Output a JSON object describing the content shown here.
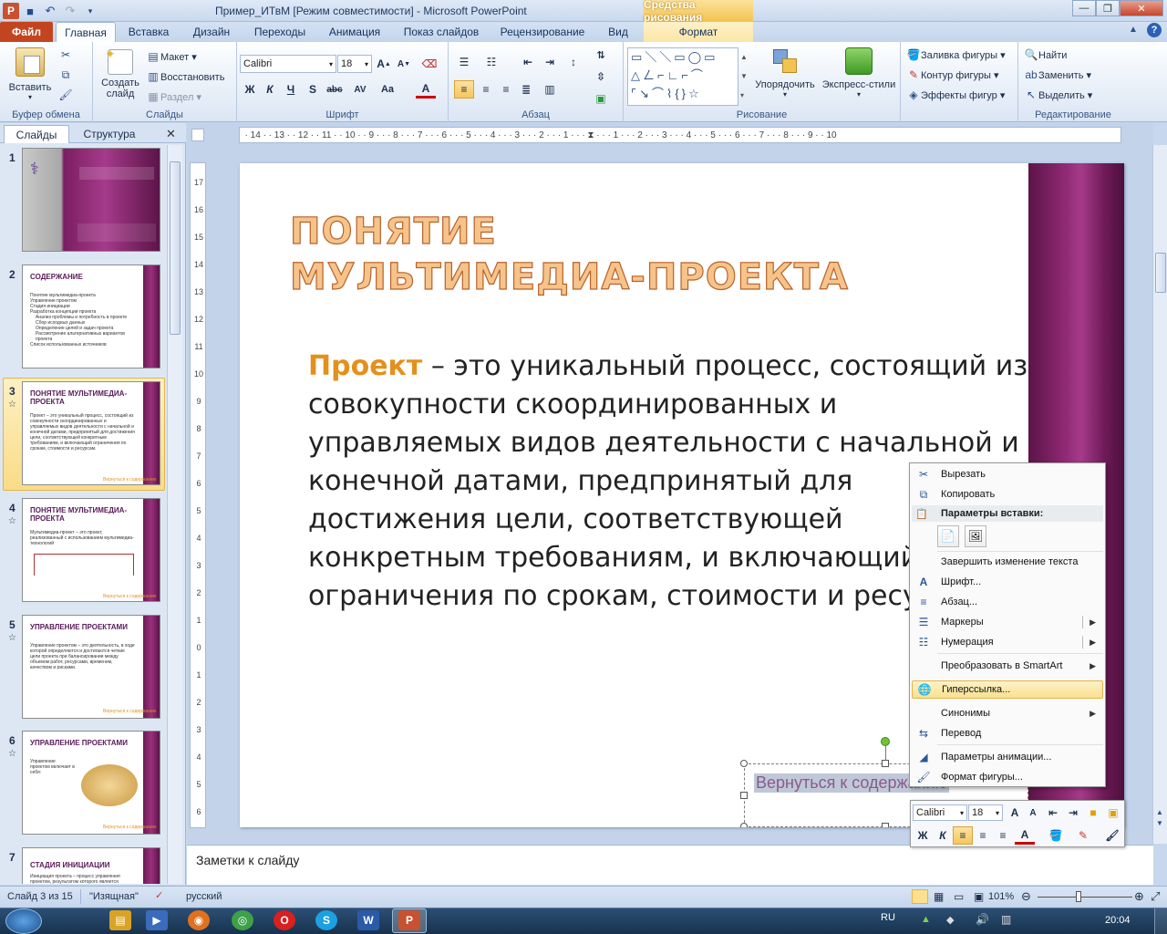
{
  "window": {
    "title": "Пример_ИТвМ [Режим совместимости] - Microsoft PowerPoint",
    "contextual_tab_group": "Средства рисования"
  },
  "tabs": [
    {
      "label": "Файл"
    },
    {
      "label": "Главная"
    },
    {
      "label": "Вставка"
    },
    {
      "label": "Дизайн"
    },
    {
      "label": "Переходы"
    },
    {
      "label": "Анимация"
    },
    {
      "label": "Показ слайдов"
    },
    {
      "label": "Рецензирование"
    },
    {
      "label": "Вид"
    },
    {
      "label": "Формат"
    }
  ],
  "ribbon": {
    "clipboard": {
      "paste": "Вставить",
      "label": "Буфер обмена"
    },
    "slides": {
      "new_slide": "Создать слайд",
      "layout": "Макет",
      "reset": "Восстановить",
      "section": "Раздел",
      "label": "Слайды"
    },
    "font": {
      "name": "Calibri",
      "size": "18",
      "label": "Шрифт",
      "bold": "Ж",
      "italic": "К",
      "underline": "Ч",
      "shadow": "S",
      "strike": "abc",
      "spacing": "AV",
      "case": "Aa",
      "color": "A"
    },
    "paragraph": {
      "label": "Абзац"
    },
    "drawing": {
      "arrange": "Упорядочить",
      "quick_styles": "Экспресс-стили",
      "fill": "Заливка фигуры",
      "outline": "Контур фигуры",
      "effects": "Эффекты фигур",
      "label": "Рисование"
    },
    "editing": {
      "find": "Найти",
      "replace": "Заменить",
      "select": "Выделить",
      "label": "Редактирование"
    }
  },
  "left_panel": {
    "tabs": [
      {
        "label": "Слайды"
      },
      {
        "label": "Структура"
      }
    ],
    "thumbnails": [
      {
        "num": "1",
        "title": "",
        "lines": []
      },
      {
        "num": "2",
        "title": "СОДЕРЖАНИЕ",
        "lines": [
          "Понятие мультимедиа-проекта",
          "Управление проектом",
          "Стадия инициации",
          "Разработка концепции проекта",
          "Анализ проблемы и потребность в проекте",
          "Сбор исходных данных",
          "Определение целей и задач проекта",
          "Рассмотрение альтернативных вариантов проекта",
          "Список использованных источников"
        ]
      },
      {
        "num": "3",
        "title": "ПОНЯТИЕ МУЛЬТИМЕДИА-ПРОЕКТА",
        "lines": [
          "Проект – это уникальный процесс, состоящий из совокупности скоординированных и управляемых видов деятельности с начальной и конечной датами, предпринятый для достижения цели, соответствующей конкретным требованиям, и включающий ограничения по срокам, стоимости и ресурсам."
        ]
      },
      {
        "num": "4",
        "title": "ПОНЯТИЕ МУЛЬТИМЕДИА-ПРОЕКТА",
        "lines": [
          "Мультимедиа-проект – это проект, реализованный с использованием мультимедиа-технологий"
        ]
      },
      {
        "num": "5",
        "title": "УПРАВЛЕНИЕ ПРОЕКТАМИ",
        "lines": [
          "Управление проектом – это деятельность, в ходе которой определяются и достигаются четкие цели проекта при балансировании между объемом работ, ресурсами, временем, качеством и рисками."
        ]
      },
      {
        "num": "6",
        "title": "УПРАВЛЕНИЕ ПРОЕКТАМИ",
        "lines": [
          "Управление проектом включает в себя:"
        ]
      },
      {
        "num": "7",
        "title": "СТАДИЯ ИНИЦИАЦИИ",
        "lines": [
          "Инициация проекта – процесс управления проектом, результатом которого является"
        ]
      }
    ]
  },
  "slide": {
    "title": "ПОНЯТИЕ МУЛЬТИМЕДИА-ПРОЕКТА",
    "keyword": "Проект",
    "body": " – это уникальный процесс, состоящий из совокупности скоординированных и управляемых видов деятельности с начальной и конечной датами, предпринятый для достижения цели, соответствующей конкретным требованиям, и включающий ограничения по срокам, стоимости и ресурсам.",
    "back_link": "Вернуться к содержанию"
  },
  "context_menu": {
    "cut": "Вырезать",
    "copy": "Копировать",
    "paste_options": "Параметры вставки:",
    "finish_edit": "Завершить изменение текста",
    "font": "Шрифт...",
    "paragraph": "Абзац...",
    "bullets": "Маркеры",
    "numbering": "Нумерация",
    "smartart": "Преобразовать в SmartArt",
    "hyperlink": "Гиперссылка...",
    "synonyms": "Синонимы",
    "translate": "Перевод",
    "animation": "Параметры анимации...",
    "format_shape": "Формат фигуры..."
  },
  "mini_toolbar": {
    "font": "Calibri",
    "size": "18"
  },
  "notes": {
    "placeholder": "Заметки к слайду"
  },
  "status": {
    "slide": "Слайд 3 из 15",
    "theme": "\"Изящная\"",
    "language": "русский",
    "zoom": "101%"
  },
  "taskbar": {
    "lang": "RU",
    "time": "20:04"
  }
}
